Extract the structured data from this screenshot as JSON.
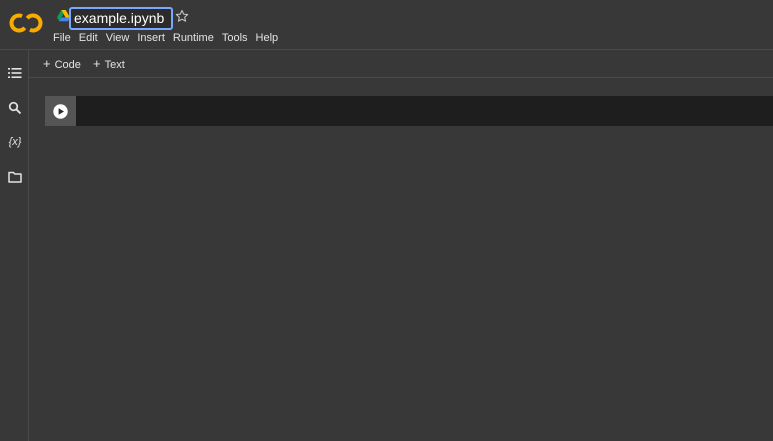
{
  "header": {
    "notebook_title": "example.ipynb",
    "menu": [
      "File",
      "Edit",
      "View",
      "Insert",
      "Runtime",
      "Tools",
      "Help"
    ]
  },
  "toolbar": {
    "code_label": "Code",
    "text_label": "Text"
  },
  "sidebar": {
    "icons": [
      "table-of-contents-icon",
      "search-icon",
      "variables-icon",
      "files-icon"
    ],
    "variables_glyph": "{x}"
  },
  "cell": {
    "content": ""
  },
  "colors": {
    "brand_orange": "#f9ab00",
    "title_focus_border": "#7aa8ff",
    "background": "#383838",
    "cell_background": "#1e1e1e"
  }
}
